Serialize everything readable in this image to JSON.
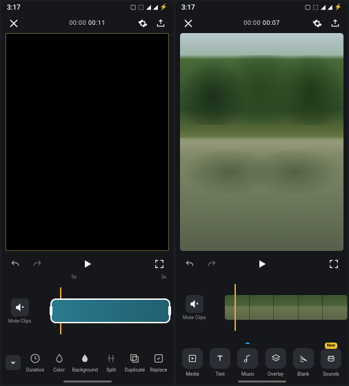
{
  "left": {
    "status": {
      "time": "3:17",
      "icons": [
        "image",
        "vr",
        "signal",
        "signal",
        "battery"
      ]
    },
    "top": {
      "elapsed": "00:00",
      "total": "00:11"
    },
    "ruler": {
      "start": "0s",
      "end": "3s"
    },
    "mute": {
      "label": "Mute Clips"
    },
    "tools": [
      {
        "name": "duration",
        "label": "Duration"
      },
      {
        "name": "color",
        "label": "Color"
      },
      {
        "name": "background",
        "label": "Background"
      },
      {
        "name": "split",
        "label": "Split"
      },
      {
        "name": "duplicate",
        "label": "Duplicate"
      },
      {
        "name": "replace",
        "label": "Replace"
      }
    ]
  },
  "right": {
    "status": {
      "time": "3:17",
      "icons": [
        "image",
        "vr",
        "signal",
        "signal",
        "battery"
      ]
    },
    "top": {
      "elapsed": "00:00",
      "total": "00:07"
    },
    "mute": {
      "label": "Mute Clips"
    },
    "tools": [
      {
        "name": "media",
        "label": "Media"
      },
      {
        "name": "text",
        "label": "Text"
      },
      {
        "name": "music",
        "label": "Music",
        "badge": "blue",
        "badge_text": " "
      },
      {
        "name": "overlay",
        "label": "Overlay"
      },
      {
        "name": "blank",
        "label": "Blank"
      },
      {
        "name": "sounds",
        "label": "Sounds",
        "badge": "yellow",
        "badge_text": "New"
      }
    ]
  }
}
